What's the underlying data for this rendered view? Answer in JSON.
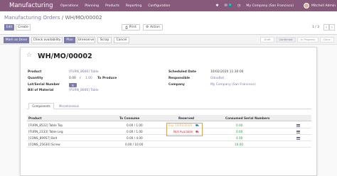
{
  "topbar": {
    "brand": "Manufacturing",
    "menu": [
      "Operations",
      "Planning",
      "Products",
      "Reporting",
      "Configuration"
    ],
    "chat_count": "3",
    "company": "My Company (San Francisco)",
    "user": "Mitchell Admin"
  },
  "breadcrumb": {
    "parent": "Manufacturing Orders",
    "separator": " / ",
    "current": "WH/MO/00002"
  },
  "toolbar": {
    "edit": "Edit",
    "create": "Create",
    "print": "Print",
    "action": "Action",
    "pager": "1 / 3",
    "prev": "‹",
    "next": "›"
  },
  "statusbar": {
    "buttons": [
      "Mark as Done",
      "Check availability",
      "Plan",
      "Unreserve",
      "Scrap",
      "Cancel"
    ],
    "stages": [
      "Draft",
      "Confirmed",
      "In Progress",
      "Done"
    ],
    "active_stage": "Confirmed"
  },
  "form": {
    "title": "WH/MO/00002",
    "left": {
      "product_label": "Product",
      "product_value": "[FURN_8666] Table",
      "quantity_label": "Quantity",
      "quantity_done": "0.00",
      "quantity_sep": "/",
      "quantity_total": "1.00",
      "to_produce": "To Produce",
      "lot_label": "Lot/Serial Number",
      "bom_label": "Bill of Material",
      "bom_value": "[FURN_8666] Table"
    },
    "right": {
      "scheduled_label": "Scheduled Date",
      "scheduled_value": "10/02/2020 11:30:00",
      "responsible_label": "Responsible",
      "responsible_value": "OdooBot",
      "company_label": "Company",
      "company_value": "My Company (San Francisco)"
    }
  },
  "tabs": [
    "Components",
    "Miscellaneous"
  ],
  "table": {
    "headers": {
      "product": "Product",
      "to_consume": "To Consume",
      "reserved": "Reserved",
      "consumed": "Consumed",
      "serial": "Serial Numbers"
    },
    "rows": [
      {
        "product": "[FURN_8522] Table Top",
        "to_consume": "0.00 / 1.00",
        "reserved": "Exp 10/02/2020",
        "consumed": "0.00"
      },
      {
        "product": "[FURN_2333] Table Leg",
        "to_consume": "0.00 / 1.00",
        "reserved": "Not Available",
        "consumed": "0.00"
      },
      {
        "product": "[CONS_89957] Bolt",
        "to_consume": "0.00 / 4.00",
        "reserved": "",
        "consumed": "4.00"
      },
      {
        "product": "[CONS_25630] Screw",
        "to_consume": "0.00 / 10.00",
        "reserved": "",
        "consumed": "10.00"
      }
    ]
  },
  "colors": {
    "brand": "#875a7b",
    "primary": "#7c7bad",
    "green": "#28a745",
    "red": "#dc3545",
    "orange": "#f0ad4e"
  }
}
